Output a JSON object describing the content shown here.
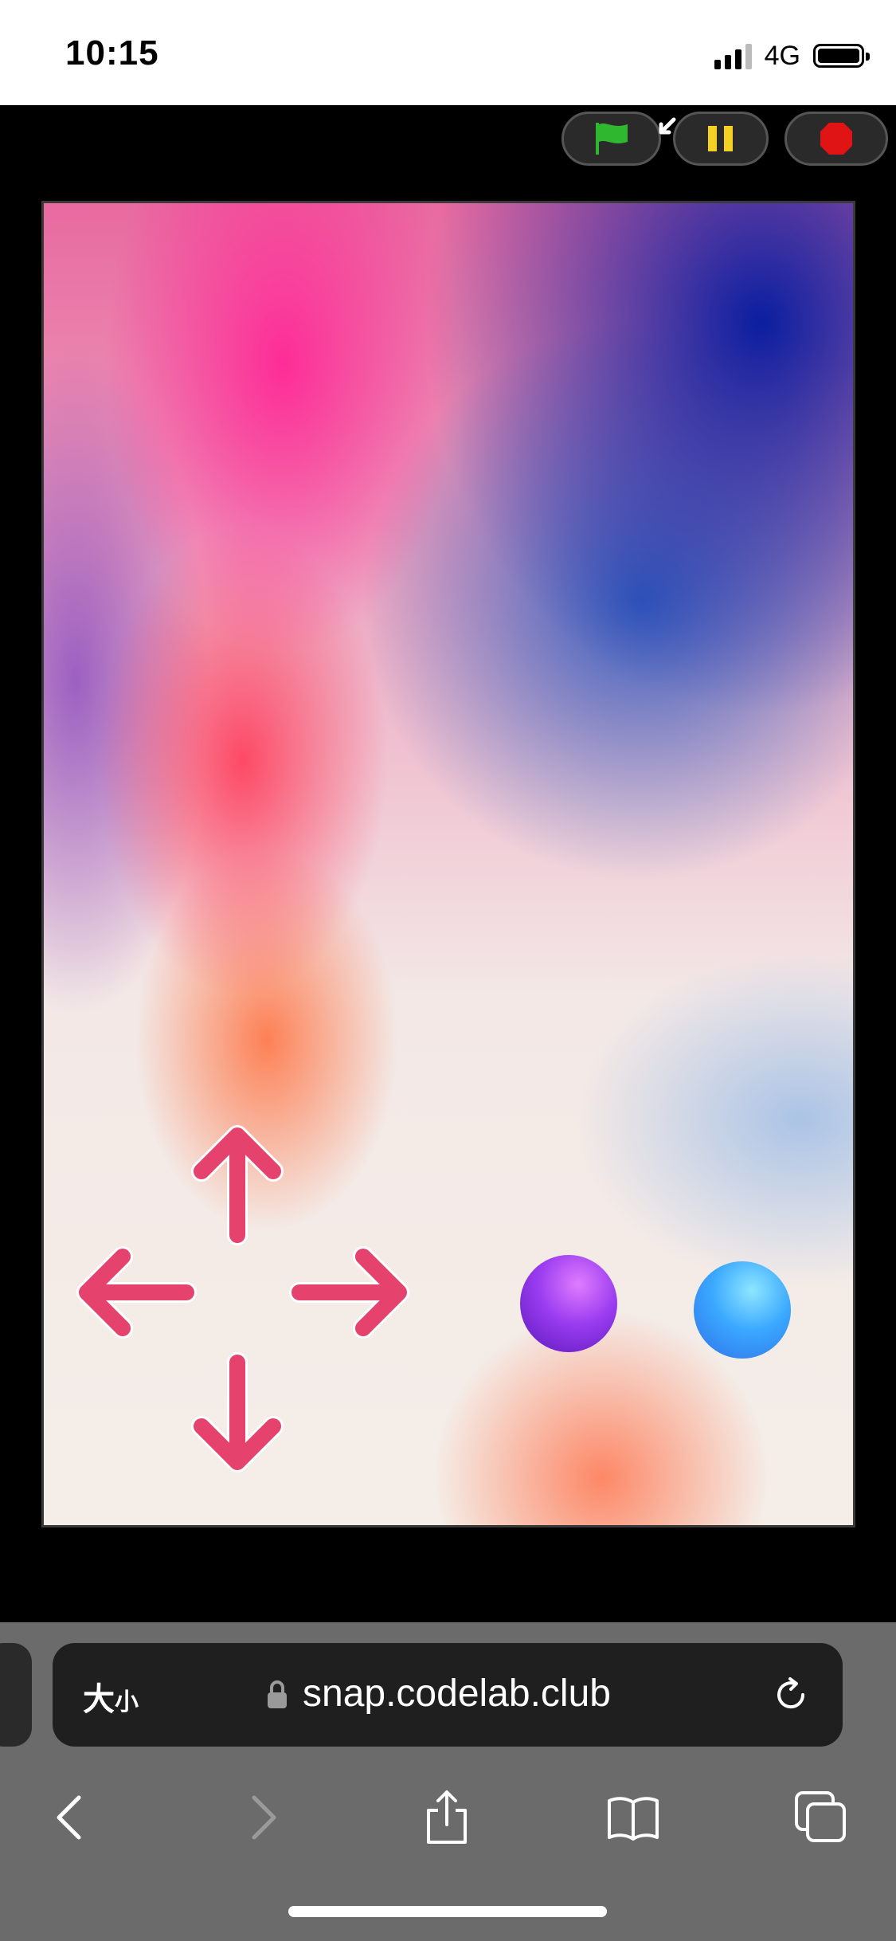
{
  "status_bar": {
    "time": "10:15",
    "network": "4G",
    "signal_bars": 4,
    "battery_level": 0.95
  },
  "toolbar": {
    "flag_icon": "green-flag-icon",
    "pause_icon": "pause-icon",
    "stop_icon": "stop-sign-icon",
    "colors": {
      "flag": "#2fb72f",
      "pause": "#f2d024",
      "stop": "#e01414"
    }
  },
  "stage": {
    "sprites": [
      "arrow-up",
      "arrow-down",
      "arrow-left",
      "arrow-right",
      "purple-ball",
      "blue-ball"
    ],
    "colors": {
      "arrow": "#e6426e",
      "purple_ball": "#8a30e0",
      "blue_ball": "#3aa0ff"
    }
  },
  "browser": {
    "size_label_big": "大",
    "size_label_small": "小",
    "url": "snap.codelab.club",
    "nav_icons": [
      "back-icon",
      "forward-icon",
      "share-icon",
      "bookmarks-icon",
      "tabs-icon"
    ]
  }
}
